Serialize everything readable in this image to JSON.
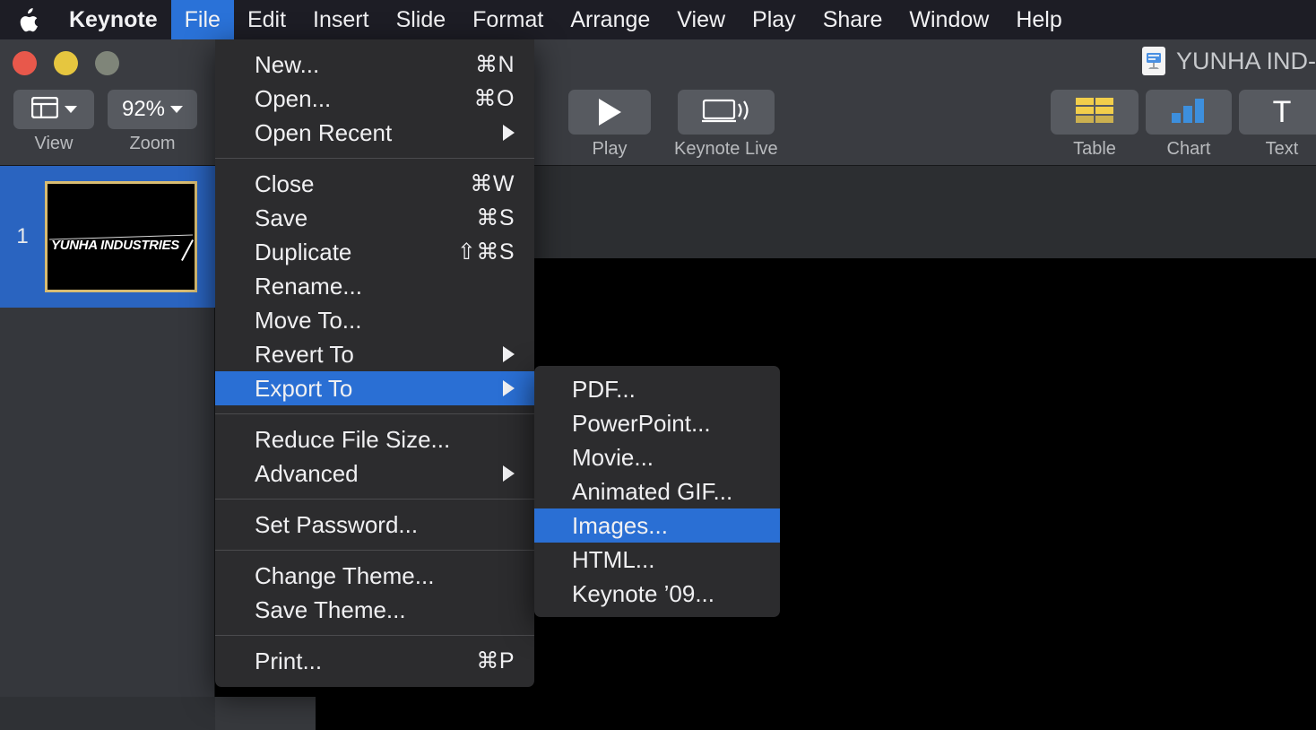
{
  "menubar": {
    "apple_icon": "apple-logo-icon",
    "items": [
      {
        "label": "Keynote",
        "active": false,
        "bold": true
      },
      {
        "label": "File",
        "active": true,
        "bold": false
      },
      {
        "label": "Edit",
        "active": false,
        "bold": false
      },
      {
        "label": "Insert",
        "active": false,
        "bold": false
      },
      {
        "label": "Slide",
        "active": false,
        "bold": false
      },
      {
        "label": "Format",
        "active": false,
        "bold": false
      },
      {
        "label": "Arrange",
        "active": false,
        "bold": false
      },
      {
        "label": "View",
        "active": false,
        "bold": false
      },
      {
        "label": "Play",
        "active": false,
        "bold": false
      },
      {
        "label": "Share",
        "active": false,
        "bold": false
      },
      {
        "label": "Window",
        "active": false,
        "bold": false
      },
      {
        "label": "Help",
        "active": false,
        "bold": false
      }
    ]
  },
  "window": {
    "document_title": "YUNHA IND-",
    "doc_icon": "keynote-document-icon"
  },
  "toolbar": {
    "view": {
      "label": "View",
      "icon": "layout-panels-icon"
    },
    "zoom": {
      "label": "Zoom",
      "value": "92%"
    },
    "play": {
      "label": "Play",
      "icon": "play-triangle-icon"
    },
    "keynote_live": {
      "label": "Keynote Live",
      "icon": "display-broadcast-icon"
    },
    "table": {
      "label": "Table",
      "icon": "table-grid-icon",
      "color": "#f2ce4b"
    },
    "chart": {
      "label": "Chart",
      "icon": "bar-chart-icon",
      "color": "#3d8fdd"
    },
    "text": {
      "label": "Text",
      "icon": "text-t-icon"
    }
  },
  "navigator": {
    "slides": [
      {
        "number": "1",
        "text": "YUNHA INDUSTRIES",
        "selected": true,
        "selection_color": "#2a64c0",
        "border_color": "#d8bc72"
      }
    ]
  },
  "file_menu": {
    "groups": [
      [
        {
          "label": "New...",
          "shortcut": "⌘N",
          "submenu": false
        },
        {
          "label": "Open...",
          "shortcut": "⌘O",
          "submenu": false
        },
        {
          "label": "Open Recent",
          "shortcut": "",
          "submenu": true
        }
      ],
      [
        {
          "label": "Close",
          "shortcut": "⌘W",
          "submenu": false
        },
        {
          "label": "Save",
          "shortcut": "⌘S",
          "submenu": false
        },
        {
          "label": "Duplicate",
          "shortcut": "⇧⌘S",
          "submenu": false
        },
        {
          "label": "Rename...",
          "shortcut": "",
          "submenu": false
        },
        {
          "label": "Move To...",
          "shortcut": "",
          "submenu": false
        },
        {
          "label": "Revert To",
          "shortcut": "",
          "submenu": true
        },
        {
          "label": "Export To",
          "shortcut": "",
          "submenu": true,
          "highlighted": true
        }
      ],
      [
        {
          "label": "Reduce File Size...",
          "shortcut": "",
          "submenu": false
        },
        {
          "label": "Advanced",
          "shortcut": "",
          "submenu": true
        }
      ],
      [
        {
          "label": "Set Password...",
          "shortcut": "",
          "submenu": false
        }
      ],
      [
        {
          "label": "Change Theme...",
          "shortcut": "",
          "submenu": false
        },
        {
          "label": "Save Theme...",
          "shortcut": "",
          "submenu": false
        }
      ],
      [
        {
          "label": "Print...",
          "shortcut": "⌘P",
          "submenu": false
        }
      ]
    ]
  },
  "export_submenu": {
    "items": [
      {
        "label": "PDF...",
        "highlighted": false
      },
      {
        "label": "PowerPoint...",
        "highlighted": false
      },
      {
        "label": "Movie...",
        "highlighted": false
      },
      {
        "label": "Animated GIF...",
        "highlighted": false
      },
      {
        "label": "Images...",
        "highlighted": true
      },
      {
        "label": "HTML...",
        "highlighted": false
      },
      {
        "label": "Keynote ’09...",
        "highlighted": false
      }
    ]
  },
  "colors": {
    "menubar_bg": "#1d1d25",
    "menu_bg": "#2c2c2e",
    "highlight_blue": "#2a6fd4",
    "toolbar_bg": "#3a3c41",
    "navigator_bg": "#35373c",
    "canvas_black": "#000000"
  }
}
